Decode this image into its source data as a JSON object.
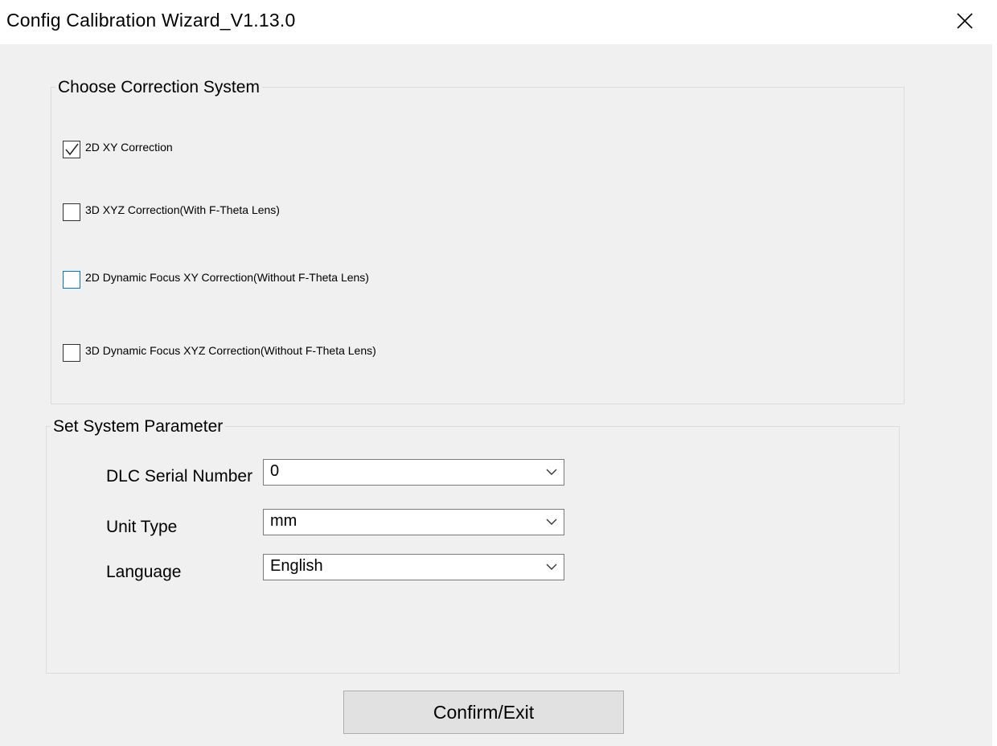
{
  "window": {
    "title": "Config Calibration Wizard_V1.13.0"
  },
  "correction_group": {
    "title": "Choose Correction System",
    "options": [
      {
        "label": "2D XY Correction",
        "checked": true
      },
      {
        "label": "3D XYZ Correction(With F-Theta Lens)",
        "checked": false
      },
      {
        "label": "2D Dynamic Focus XY Correction(Without F-Theta Lens)",
        "checked": false
      },
      {
        "label": "3D Dynamic Focus XYZ Correction(Without F-Theta Lens)",
        "checked": false
      }
    ]
  },
  "parameter_group": {
    "title": "Set System Parameter",
    "dlc_serial": {
      "label": "DLC Serial Number",
      "value": "0"
    },
    "unit_type": {
      "label": "Unit Type",
      "value": "mm"
    },
    "language": {
      "label": "Language",
      "value": "English"
    }
  },
  "actions": {
    "confirm_label": "Confirm/Exit"
  },
  "colors": {
    "window_bg": "#f0f0f0",
    "focus_accent": "#0078d7"
  }
}
